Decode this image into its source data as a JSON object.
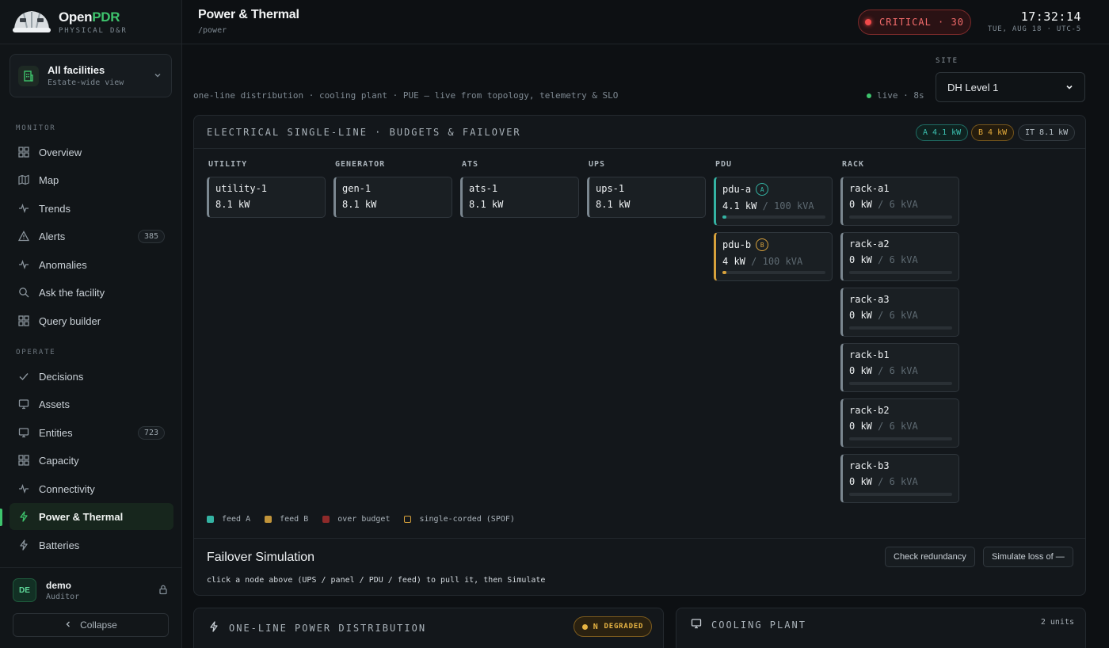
{
  "brand": {
    "name_prefix": "Open",
    "name_accent": "PDR",
    "tagline": "PHYSICAL D&R",
    "accent_color": "#3ec46d"
  },
  "facility": {
    "title": "All facilities",
    "subtitle": "Estate-wide view"
  },
  "sidebar": {
    "monitor_label": "MONITOR",
    "monitor_items": [
      {
        "label": "Overview",
        "icon": "grid-icon"
      },
      {
        "label": "Map",
        "icon": "map-icon"
      },
      {
        "label": "Trends",
        "icon": "pulse-icon"
      },
      {
        "label": "Alerts",
        "icon": "warning-icon",
        "badge": "385"
      },
      {
        "label": "Anomalies",
        "icon": "pulse-icon"
      },
      {
        "label": "Ask the facility",
        "icon": "search-icon"
      },
      {
        "label": "Query builder",
        "icon": "grid-icon"
      }
    ],
    "operate_label": "OPERATE",
    "operate_items": [
      {
        "label": "Decisions",
        "icon": "check-icon"
      },
      {
        "label": "Assets",
        "icon": "monitor-icon"
      },
      {
        "label": "Entities",
        "icon": "monitor-icon",
        "badge": "723"
      },
      {
        "label": "Capacity",
        "icon": "grid-icon"
      },
      {
        "label": "Connectivity",
        "icon": "pulse-icon"
      },
      {
        "label": "Power & Thermal",
        "icon": "bolt-icon",
        "active": true
      },
      {
        "label": "Batteries",
        "icon": "bolt-icon"
      }
    ]
  },
  "user": {
    "initials": "DE",
    "name": "demo",
    "role": "Auditor"
  },
  "collapse_label": "Collapse",
  "header": {
    "title": "Power & Thermal",
    "path": "/power",
    "critical_label": "CRITICAL · 30",
    "time": "17:32:14",
    "date": "TUE, AUG 18 · UTC-5"
  },
  "subtitle": "one-line distribution · cooling plant · PUE — live from topology, telemetry & SLO",
  "live_status": "live · 8s",
  "site": {
    "label": "SITE",
    "value": "DH Level 1"
  },
  "single_line": {
    "title": "ELECTRICAL SINGLE-LINE · BUDGETS & FAILOVER",
    "feed_a": "A 4.1 kW",
    "feed_b": "B 4 kW",
    "it_total": "IT 8.1 kW",
    "columns": [
      "UTILITY",
      "GENERATOR",
      "ATS",
      "UPS",
      "PDU",
      "RACK"
    ],
    "chain": [
      {
        "name": "utility-1",
        "value": "8.1 kW"
      },
      {
        "name": "gen-1",
        "value": "8.1 kW"
      },
      {
        "name": "ats-1",
        "value": "8.1 kW"
      },
      {
        "name": "ups-1",
        "value": "8.1 kW"
      }
    ],
    "pdus": [
      {
        "name": "pdu-a",
        "feed": "A",
        "value": "4.1 kW",
        "capacity": "/ 100 kVA",
        "utilization": 0.041
      },
      {
        "name": "pdu-b",
        "feed": "B",
        "value": "4 kW",
        "capacity": "/ 100 kVA",
        "utilization": 0.04
      }
    ],
    "racks": [
      {
        "name": "rack-a1",
        "value": "0 kW",
        "capacity": "/ 6 kVA",
        "utilization": 0
      },
      {
        "name": "rack-a2",
        "value": "0 kW",
        "capacity": "/ 6 kVA",
        "utilization": 0
      },
      {
        "name": "rack-a3",
        "value": "0 kW",
        "capacity": "/ 6 kVA",
        "utilization": 0
      },
      {
        "name": "rack-b1",
        "value": "0 kW",
        "capacity": "/ 6 kVA",
        "utilization": 0
      },
      {
        "name": "rack-b2",
        "value": "0 kW",
        "capacity": "/ 6 kVA",
        "utilization": 0
      },
      {
        "name": "rack-b3",
        "value": "0 kW",
        "capacity": "/ 6 kVA",
        "utilization": 0
      }
    ],
    "legend": [
      {
        "label": "feed A",
        "color": "#34b3a3"
      },
      {
        "label": "feed B",
        "color": "#d7a13b"
      },
      {
        "label": "over budget",
        "color": "#c0392b"
      },
      {
        "label": "single-corded (SPOF)",
        "color": "outline-#d7a13b"
      }
    ],
    "colors": {
      "feed_a": "#34b3a3",
      "feed_b": "#d7a13b"
    }
  },
  "failover": {
    "title": "Failover Simulation",
    "description": "click a node above (UPS / panel / PDU / feed) to pull it, then Simulate",
    "check_label": "Check redundancy",
    "simulate_label": "Simulate loss of —"
  },
  "one_line_card": {
    "title": "ONE-LINE POWER DISTRIBUTION",
    "status_letter": "N",
    "status": "DEGRADED"
  },
  "cooling_card": {
    "title": "COOLING PLANT",
    "units": "2 units"
  }
}
